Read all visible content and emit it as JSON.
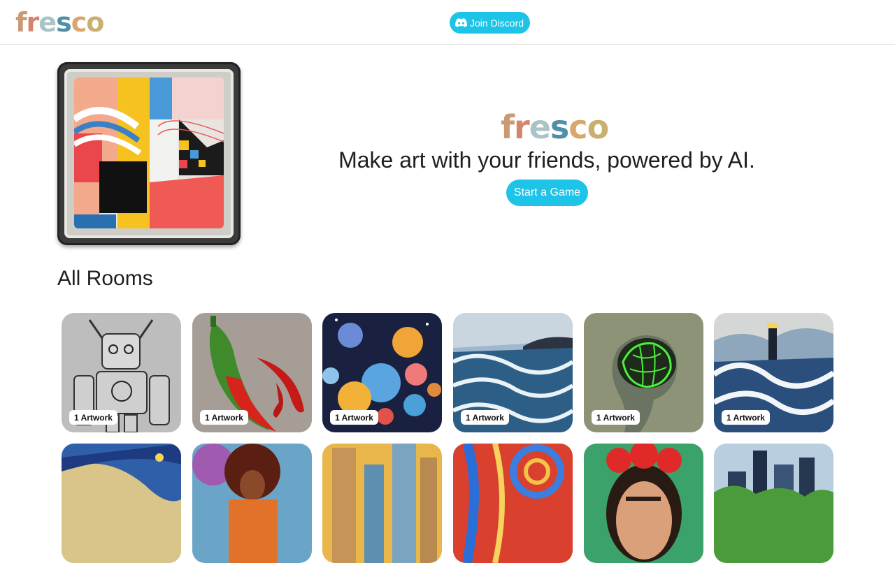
{
  "header": {
    "logo_letters": [
      "f",
      "r",
      "e",
      "s",
      "c",
      "o"
    ],
    "discord_label": "Join Discord"
  },
  "hero": {
    "logo_letters": [
      "f",
      "r",
      "e",
      "s",
      "c",
      "o"
    ],
    "tagline": "Make art with your friends, powered by AI.",
    "start_label": "Start a Game"
  },
  "rooms_title": "All Rooms",
  "rooms": [
    {
      "badge": "1 Artwork",
      "icon": "robot-sketch-artwork"
    },
    {
      "badge": "1 Artwork",
      "icon": "chili-peppers-artwork"
    },
    {
      "badge": "1 Artwork",
      "icon": "planets-artwork"
    },
    {
      "badge": "1 Artwork",
      "icon": "ocean-waves-artwork"
    },
    {
      "badge": "1 Artwork",
      "icon": "neon-brain-artwork"
    },
    {
      "badge": "1 Artwork",
      "icon": "lighthouse-waves-artwork"
    },
    {
      "badge": "",
      "icon": "starry-coast-artwork"
    },
    {
      "badge": "",
      "icon": "guitarist-portrait-artwork"
    },
    {
      "badge": "",
      "icon": "city-skyline-artwork"
    },
    {
      "badge": "",
      "icon": "psychedelic-swirl-artwork"
    },
    {
      "badge": "",
      "icon": "flower-crown-portrait-artwork"
    },
    {
      "badge": "",
      "icon": "green-city-artwork"
    }
  ],
  "colors": {
    "accent": "#1ec3e8",
    "text": "#1f1f1f",
    "divider": "#e5e5e5"
  }
}
